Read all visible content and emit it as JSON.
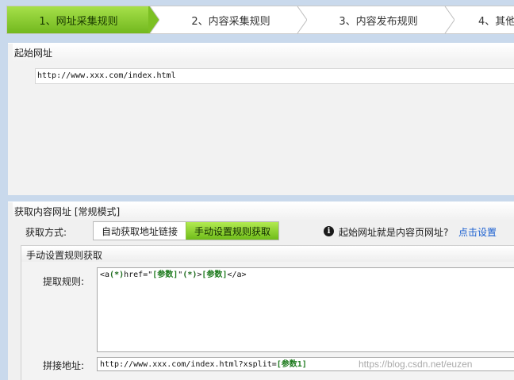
{
  "steps": [
    {
      "label": "1、网址采集规则",
      "active": true
    },
    {
      "label": "2、内容采集规则",
      "active": false
    },
    {
      "label": "3、内容发布规则",
      "active": false
    },
    {
      "label": "4、其他",
      "active": false
    }
  ],
  "start_url": {
    "title": "起始网址",
    "value": "http://www.xxx.com/index.html"
  },
  "content_url": {
    "title": "获取内容网址 [常规模式]",
    "method_label": "获取方式:",
    "methods": [
      "自动获取地址链接",
      "手动设置规则获取"
    ],
    "selected_method": "手动设置规则获取",
    "hint_text": "起始网址就是内容页网址?",
    "hint_link": "点击设置",
    "manual": {
      "title": "手动设置规则获取",
      "rule_label": "提取规则:",
      "rule_parts": {
        "p1": "<a",
        "p2": "(*)",
        "p3": "href=\"",
        "p4": "[参数]",
        "p5": "\"",
        "p6": "(*)",
        "p7": ">",
        "p8": "[参数]",
        "p9": "</a>"
      },
      "join_label": "拼接地址:",
      "join_parts": {
        "p1": "http://www.xxx.com/index.html?xsplit=",
        "p2": "[参数1]"
      }
    }
  },
  "watermark": "https://blog.csdn.net/euzen",
  "colors": {
    "active_green": "#7cc023",
    "link_blue": "#1a5fd0",
    "background": "#c9d9ec"
  }
}
